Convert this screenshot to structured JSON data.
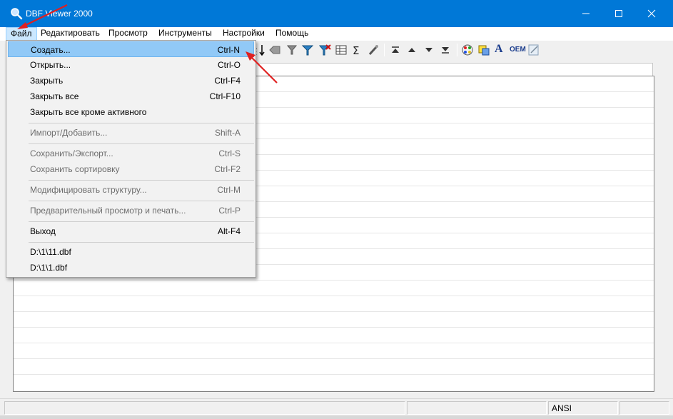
{
  "window": {
    "title": "DBF Viewer 2000",
    "icon": "magnifier-icon"
  },
  "menubar": {
    "items": [
      {
        "label": "Файл",
        "active": true
      },
      {
        "label": "Редактировать"
      },
      {
        "label": "Просмотр"
      },
      {
        "label": "Инструменты"
      },
      {
        "label": "Настройки"
      },
      {
        "label": "Помощь"
      }
    ]
  },
  "file_menu": {
    "items": [
      {
        "label": "Создать...",
        "shortcut": "Ctrl-N",
        "highlighted": true
      },
      {
        "label": "Открыть...",
        "shortcut": "Ctrl-O"
      },
      {
        "label": "Закрыть",
        "shortcut": "Ctrl-F4"
      },
      {
        "label": "Закрыть все",
        "shortcut": "Ctrl-F10"
      },
      {
        "label": "Закрыть все кроме активного",
        "shortcut": ""
      },
      {
        "label": "Импорт/Добавить...",
        "shortcut": "Shift-A",
        "disabled": true
      },
      {
        "label": "Сохранить/Экспорт...",
        "shortcut": "Ctrl-S",
        "disabled": true
      },
      {
        "label": "Сохранить сортировку",
        "shortcut": "Ctrl-F2",
        "disabled": true
      },
      {
        "label": "Модифицировать структуру...",
        "shortcut": "Ctrl-M",
        "disabled": true
      },
      {
        "label": "Предварительный просмотр и печать...",
        "shortcut": "Ctrl-P",
        "disabled": true
      },
      {
        "label": "Выход",
        "shortcut": "Alt-F4"
      },
      {
        "label": "D:\\1\\11.dbf",
        "shortcut": ""
      },
      {
        "label": "D:\\1\\1.dbf",
        "shortcut": ""
      }
    ]
  },
  "toolbar": {
    "oem_label": "OEM",
    "font_label": "A"
  },
  "statusbar": {
    "encoding": "ANSI"
  },
  "colors": {
    "titlebar": "#0078d7",
    "menu_highlight": "#91c9f7",
    "annotation_arrow": "#e02020"
  }
}
